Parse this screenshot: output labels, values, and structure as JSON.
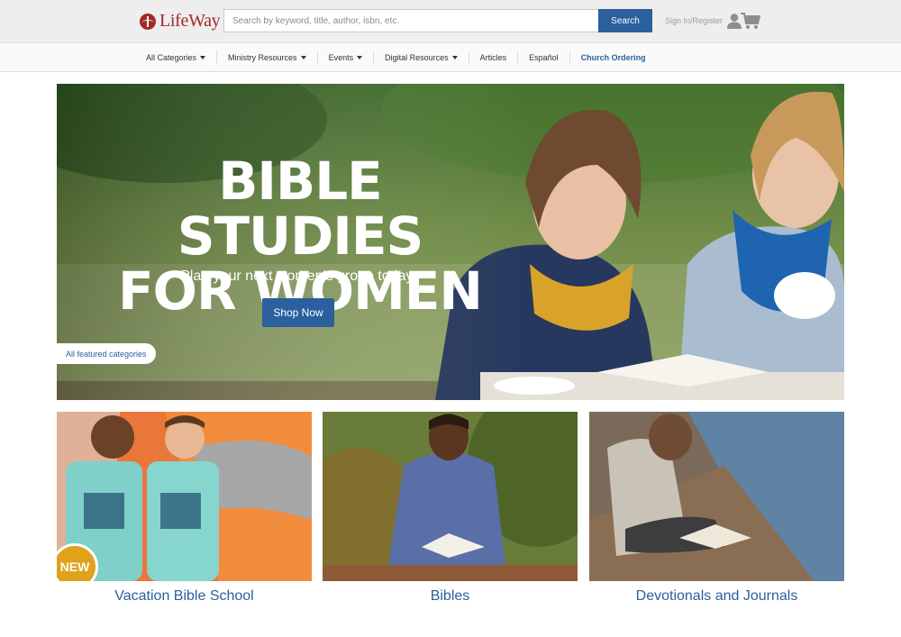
{
  "brand": {
    "logo_text": "LifeWay",
    "color": "#a02b2b"
  },
  "colors": {
    "accent": "#2b5f9e",
    "badge": "#e0a11b",
    "header_bg": "#eeeeee"
  },
  "header": {
    "search_placeholder": "Search by keyword, title, author, isbn, etc.",
    "search_value": "",
    "search_button": "Search",
    "signin_label": "Sign In/Register",
    "icons": [
      "logo-mark-icon",
      "user-icon",
      "cart-icon"
    ]
  },
  "nav": {
    "items": [
      {
        "label": "All Categories",
        "dropdown": true
      },
      {
        "label": "Ministry Resources",
        "dropdown": true
      },
      {
        "label": "Events",
        "dropdown": true
      },
      {
        "label": "Digital Resources",
        "dropdown": true
      },
      {
        "label": "Articles",
        "dropdown": false
      },
      {
        "label": "Español",
        "dropdown": false
      },
      {
        "label": "Church Ordering",
        "dropdown": false
      }
    ]
  },
  "hero": {
    "title_line1": "BIBLE STUDIES",
    "title_line2": "FOR WOMEN",
    "subtitle": "Plan your next women's group today.",
    "button": "Shop Now",
    "featured_link": "All featured categories"
  },
  "tiles": [
    {
      "label": "Vacation Bible School",
      "badge": "NEW"
    },
    {
      "label": "Bibles"
    },
    {
      "label": "Devotionals and Journals"
    }
  ]
}
